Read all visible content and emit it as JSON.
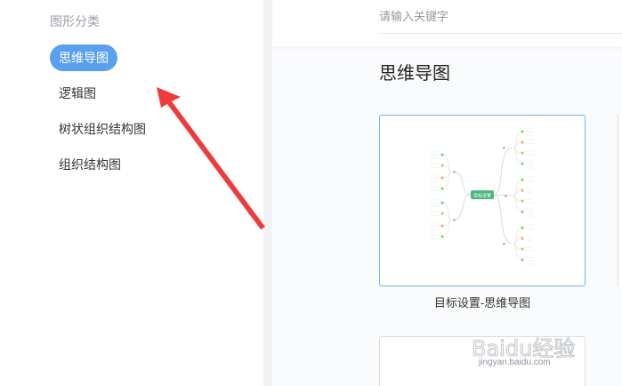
{
  "sidebar": {
    "title": "图形分类",
    "items": [
      {
        "label": "思维导图",
        "active": true
      },
      {
        "label": "逻辑图",
        "active": false
      },
      {
        "label": "树状组织结构图",
        "active": false
      },
      {
        "label": "组织结构图",
        "active": false
      }
    ]
  },
  "search": {
    "placeholder": "请输入关键字",
    "value": ""
  },
  "section": {
    "title": "思维导图"
  },
  "templates": [
    {
      "label": "目标设置-思维导图",
      "center_text": "目标设置"
    }
  ],
  "watermark": {
    "brand": "Baidu经验",
    "url": "jingyan.baidu.com"
  },
  "colors": {
    "accent": "#5b9fef",
    "card_border": "#6fb3f0",
    "arrow": "#ee3b3b",
    "mindmap_center": "#4cb77c"
  }
}
